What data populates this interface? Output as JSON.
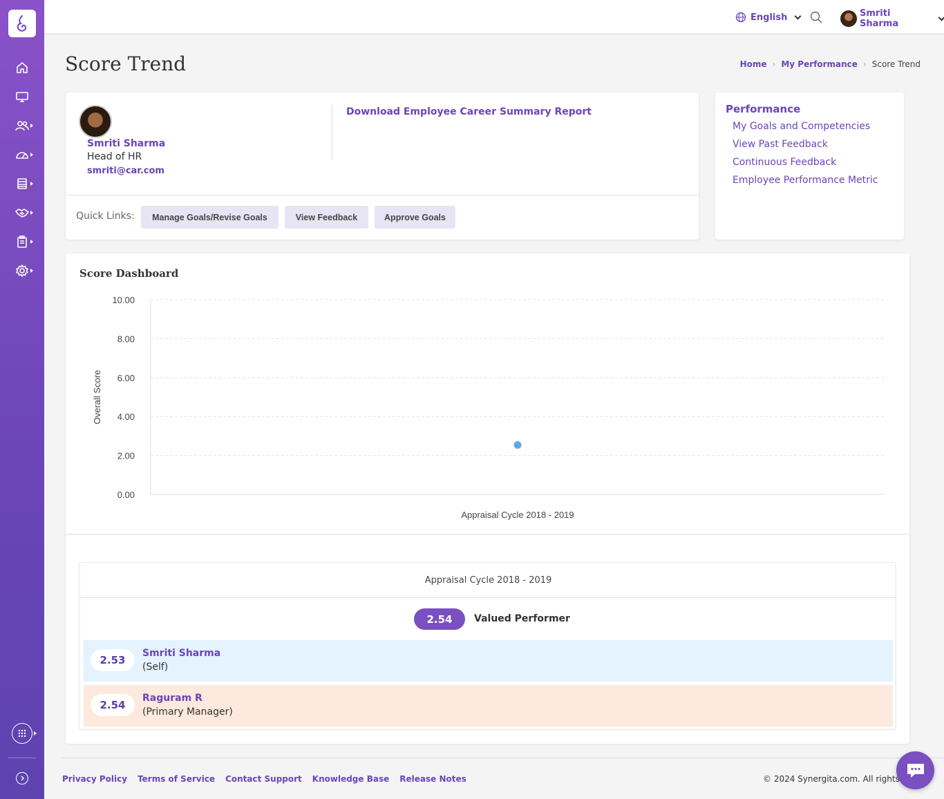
{
  "topbar": {
    "language": "English",
    "user_name": "Smriti Sharma"
  },
  "page": {
    "title": "Score Trend",
    "breadcrumb": [
      "Home",
      "My Performance",
      "Score Trend"
    ]
  },
  "profile": {
    "name": "Smriti Sharma",
    "role": "Head of HR",
    "email": "smriti@car.com",
    "download_link": "Download Employee Career Summary Report",
    "quick_links_label": "Quick Links:",
    "quick_links": [
      "Manage Goals/Revise Goals",
      "View Feedback",
      "Approve Goals"
    ]
  },
  "performance_menu": {
    "title": "Performance",
    "items": [
      "My Goals and Competencies",
      "View Past Feedback",
      "Continuous Feedback",
      "Employee Performance Metric"
    ]
  },
  "dashboard": {
    "title": "Score Dashboard"
  },
  "chart_data": {
    "type": "scatter",
    "title": "",
    "xlabel": "",
    "ylabel": "Overall Score",
    "categories": [
      "Appraisal Cycle 2018 - 2019"
    ],
    "series": [
      {
        "values": [
          2.54
        ]
      }
    ],
    "ylim": [
      0,
      10
    ],
    "yticks": [
      "0.00",
      "2.00",
      "4.00",
      "6.00",
      "8.00",
      "10.00"
    ],
    "grid": true,
    "point_color": "#5aa8ee"
  },
  "cycle_summary": {
    "title": "Appraisal Cycle 2018 - 2019",
    "overall_score": "2.54",
    "overall_label": "Valued Performer",
    "raters": [
      {
        "score": "2.53",
        "name": "Smriti Sharma",
        "role": "(Self)",
        "bg": "#e4f3fd"
      },
      {
        "score": "2.54",
        "name": "Raguram R",
        "role": "(Primary Manager)",
        "bg": "#fde9dd"
      }
    ]
  },
  "footer": {
    "links": [
      "Privacy Policy",
      "Terms of Service",
      "Contact Support",
      "Knowledge Base",
      "Release Notes"
    ],
    "copyright": "© 2024 Synergita.com. All rights res"
  },
  "colors": {
    "accent": "#6a45b8",
    "sidebar_top": "#8a52c8",
    "sidebar_bottom": "#5d43b0"
  }
}
